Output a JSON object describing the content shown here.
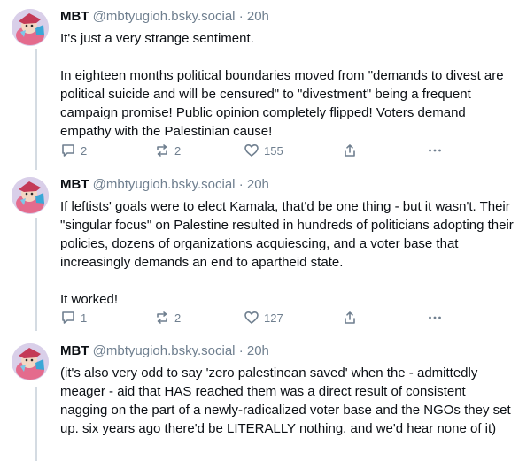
{
  "posts": [
    {
      "author": {
        "name": "MBT",
        "handle": "@mbtyugioh.bsky.social",
        "separator": "·",
        "time": "20h"
      },
      "paragraphs": [
        "It's just a very strange sentiment.",
        "In eighteen months political boundaries moved from \"demands to divest are political suicide and will be censured\" to \"divestment\" being a frequent campaign promise! Public opinion completely flipped! Voters demand empathy with the Palestinian cause!"
      ],
      "counts": {
        "replies": "2",
        "reposts": "2",
        "likes": "155"
      }
    },
    {
      "author": {
        "name": "MBT",
        "handle": "@mbtyugioh.bsky.social",
        "separator": "·",
        "time": "20h"
      },
      "paragraphs": [
        "If leftists' goals were to elect Kamala, that'd be one thing - but it wasn't. Their \"singular focus\" on Palestine resulted in hundreds of politicians adopting their policies, dozens of organizations acquiescing, and a voter base that increasingly demands an end to apartheid state.",
        "It worked!"
      ],
      "counts": {
        "replies": "1",
        "reposts": "2",
        "likes": "127"
      }
    },
    {
      "author": {
        "name": "MBT",
        "handle": "@mbtyugioh.bsky.social",
        "separator": "·",
        "time": "20h"
      },
      "paragraphs": [
        "(it's also very odd to say 'zero palestinean saved' when the - admittedly meager - aid that HAS reached them was a direct result of consistent nagging on the part of a newly-radicalized voter base and the NGOs they set up. six years ago there'd be LITERALLY nothing, and we'd hear none of it)"
      ]
    }
  ],
  "icons": {
    "reply": "speech-bubble-icon",
    "repost": "repost-arrows-icon",
    "like": "heart-icon",
    "share": "share-upload-icon",
    "more": "ellipsis-icon"
  },
  "colors": {
    "text": "#0b0f14",
    "muted": "#6f7f8f",
    "thread_line": "#d4dbe2",
    "avatar_bg": "#d9cfe9"
  }
}
